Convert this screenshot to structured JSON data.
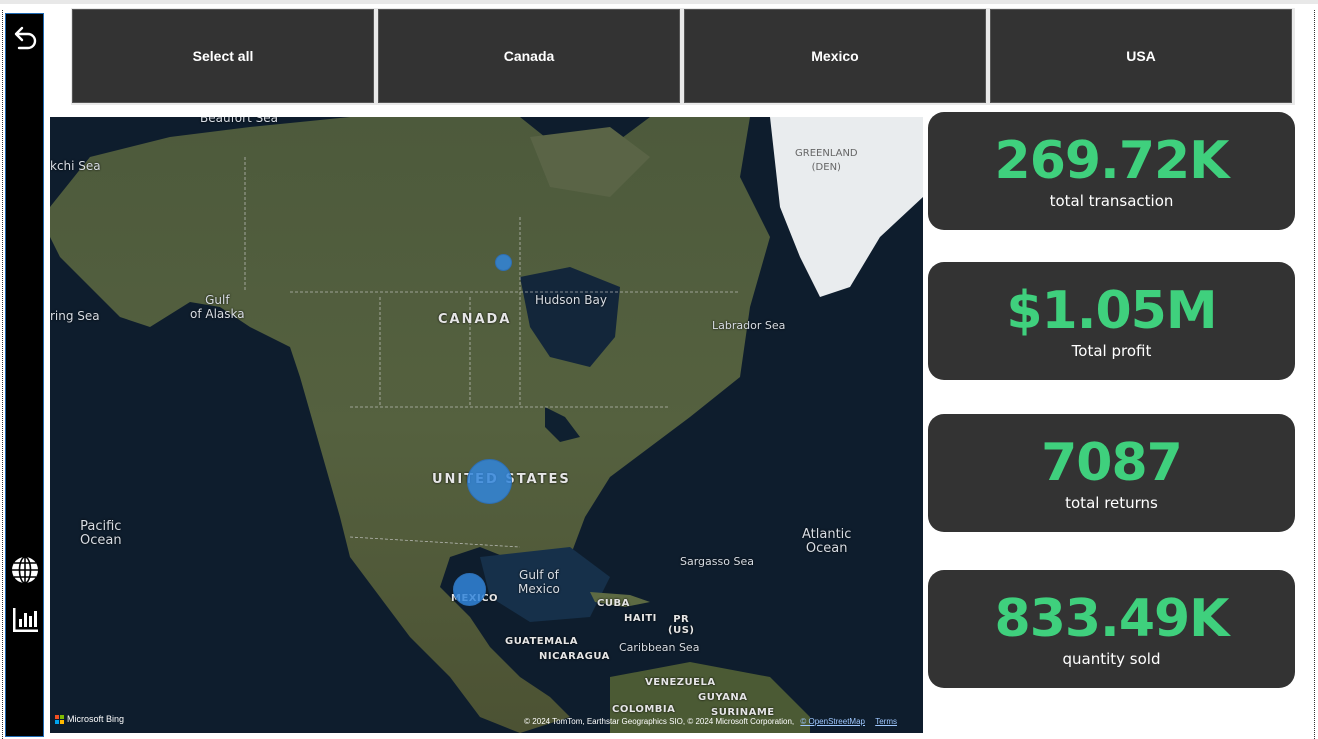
{
  "slicer": {
    "buttons": [
      {
        "label": "Select all"
      },
      {
        "label": "Canada"
      },
      {
        "label": "Mexico"
      },
      {
        "label": "USA"
      }
    ]
  },
  "sidebar": {
    "icons": [
      "back-arrow-icon",
      "globe-icon",
      "bar-chart-icon"
    ]
  },
  "map": {
    "labels": {
      "beaufort_sea": "Beaufort Sea",
      "chukchi_sea": "kchi Sea",
      "greenland": "GREENLAND\n(DEN)",
      "gulf_of_alaska": "Gulf\nof Alaska",
      "bering_sea": "ring Sea",
      "hudson_bay": "Hudson Bay",
      "canada": "CANADA",
      "labrador_sea": "Labrador Sea",
      "united_states": "UNITED STATES",
      "pacific_ocean": "Pacific\nOcean",
      "atlantic_ocean": "Atlantic\nOcean",
      "sargasso_sea": "Sargasso Sea",
      "gulf_of_mexico": "Gulf of\nMexico",
      "mexico": "MEXICO",
      "cuba": "CUBA",
      "haiti": "HAITI",
      "pr": "PR\n(US)",
      "guatemala": "GUATEMALA",
      "nicaragua": "NICARAGUA",
      "caribbean_sea": "Caribbean Sea",
      "venezuela": "VENEZUELA",
      "colombia": "COLOMBIA",
      "guyana": "GUYANA",
      "suriname": "SURINAME"
    },
    "bubbles": [
      {
        "country": "Canada",
        "relative_size": 0.2
      },
      {
        "country": "USA",
        "relative_size": 1.0
      },
      {
        "country": "Mexico",
        "relative_size": 0.7
      }
    ],
    "bubble_color": "#3185da",
    "provider": "Microsoft Bing",
    "attribution": "© 2024 TomTom, Earthstar Geographics SIO, © 2024 Microsoft Corporation,",
    "osm_link": "© OpenStreetMap",
    "terms_link": "Terms"
  },
  "cards": [
    {
      "value": "269.72K",
      "label": "total transaction"
    },
    {
      "value": "$1.05M",
      "label": "Total profit"
    },
    {
      "value": "7087",
      "label": "total returns"
    },
    {
      "value": "833.49K",
      "label": "quantity sold"
    }
  ],
  "colors": {
    "accent_green": "#3fd07d",
    "card_bg": "#333333",
    "sidebar_bg": "#000000"
  }
}
